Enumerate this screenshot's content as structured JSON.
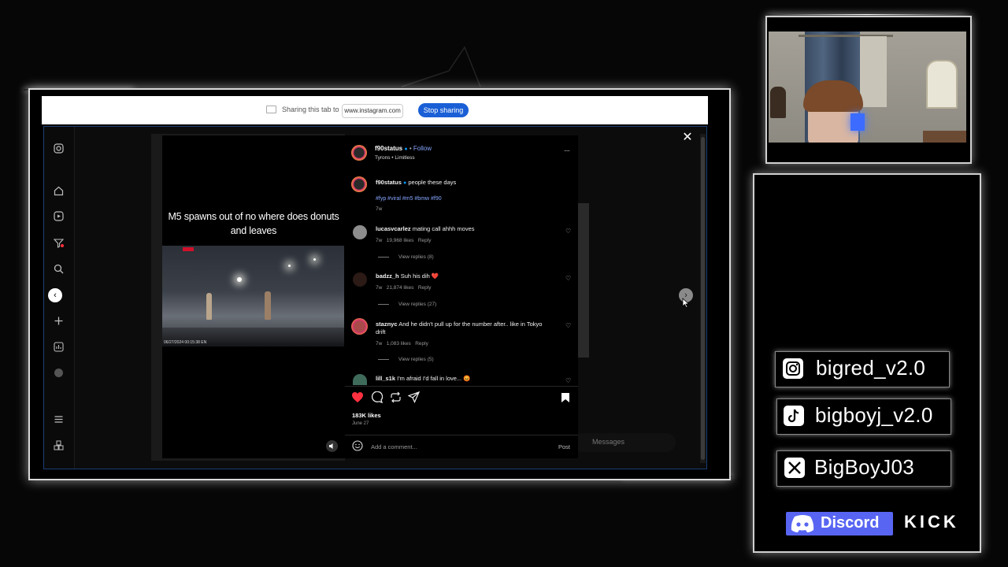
{
  "share_bar": {
    "message": "Sharing this tab to",
    "domain": "www.instagram.com",
    "stop_label": "Stop sharing"
  },
  "post": {
    "author": "f90status",
    "follow_label": "Follow",
    "audio": "Tyrons • Limitless",
    "caption_user": "f90status",
    "caption_text": "people these days",
    "hashtags": "#fyp #viral #m5 #bmw #f90",
    "caption_age": "7w",
    "video_caption": "M5 spawns out of no where does donuts and leaves",
    "video_timestamp": "06/27/2024 00:15:38  EN",
    "likes": "183K likes",
    "date": "June 27",
    "add_comment_placeholder": "Add a comment...",
    "post_label": "Post"
  },
  "comments": [
    {
      "user": "lucasvcarlez",
      "text": "mating call ahhh moves",
      "age": "7w",
      "likes": "19,968 likes",
      "reply": "Reply",
      "replies": "View replies (8)"
    },
    {
      "user": "badzz_h",
      "text": "Suh his dih",
      "emoji": "❤️",
      "age": "7w",
      "likes": "21,874 likes",
      "reply": "Reply",
      "replies": "View replies (27)"
    },
    {
      "user": "staznyc",
      "text": "And he didn't pull up for the number after.. like in Tokyo drift",
      "age": "7w",
      "likes": "1,083 likes",
      "reply": "Reply",
      "replies": "View replies (5)"
    },
    {
      "user": "lill_s1k",
      "text": "I'm afraid I'd fall in love...",
      "emoji": "😡"
    }
  ],
  "background": {
    "messages_label": "Messages"
  },
  "socials": {
    "instagram": "bigred_v2.0",
    "tiktok": "bigboyj_v2.0",
    "x": "BigBoyJ03",
    "discord": "Discord",
    "kick": "KICK"
  },
  "icons": {
    "sidebar": [
      "instagram-logo-icon",
      "home-icon",
      "reels-icon",
      "filter-icon",
      "search-icon",
      "explore-icon",
      "create-icon",
      "dashboard-icon",
      "profile-icon",
      "menu-icon",
      "also-from-meta-icon"
    ],
    "post_actions": [
      "like-icon",
      "comment-icon",
      "repost-icon",
      "share-icon",
      "save-icon"
    ]
  },
  "colors": {
    "accent_blue": "#1a5fd6",
    "like_red": "#ff3040",
    "discord": "#5865f2",
    "verified_blue": "#0095f6"
  }
}
